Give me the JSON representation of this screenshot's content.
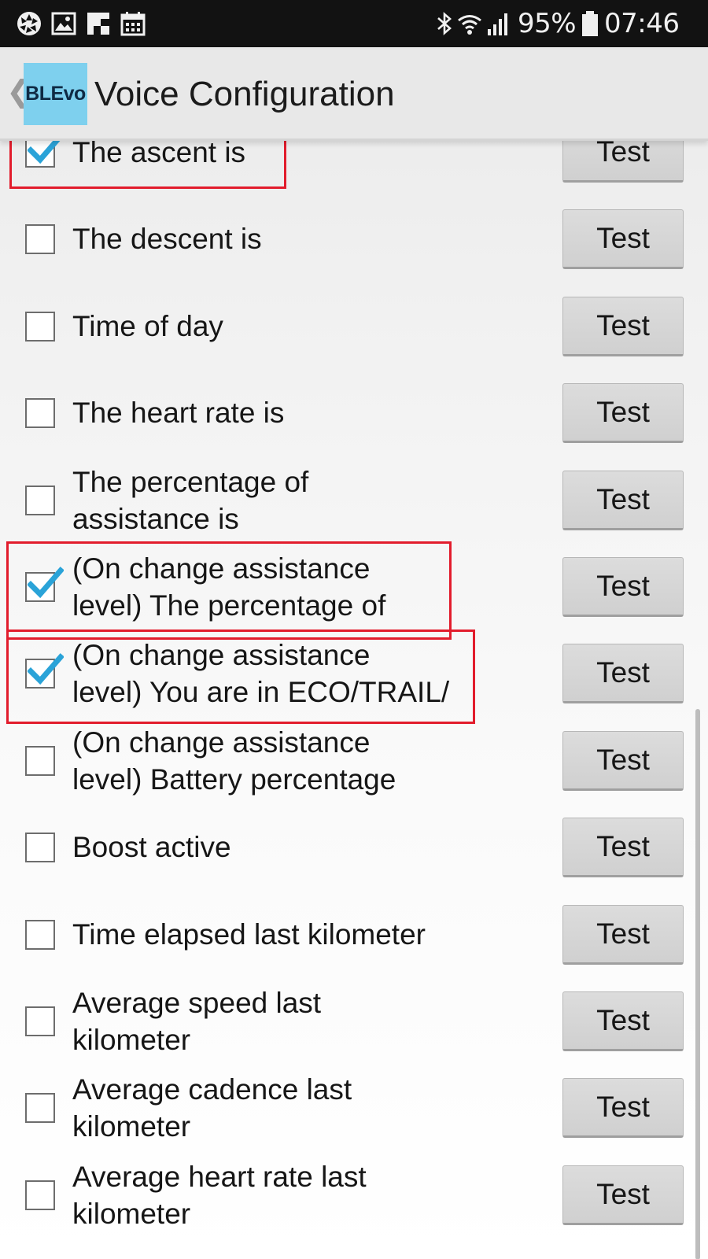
{
  "status_bar": {
    "battery": "95%",
    "time": "07:46",
    "left_icons": [
      "aperture-icon",
      "gallery-icon",
      "flipboard-icon",
      "calendar-icon"
    ],
    "right_icons": [
      "bluetooth-icon",
      "wifi-icon",
      "signal-icon",
      "battery-icon"
    ]
  },
  "header": {
    "logo_text": "BLEvo",
    "title": "Voice Configuration",
    "back_icon": "chevron-left-icon"
  },
  "colors": {
    "check_accent": "#2aa3d8",
    "highlight": "#e21c2c",
    "logo_bg": "#7ed0ee"
  },
  "rows": [
    {
      "label": "The ascent is",
      "checked": true,
      "button": "Test"
    },
    {
      "label": "The descent is",
      "checked": false,
      "button": "Test"
    },
    {
      "label": "Time of day",
      "checked": false,
      "button": "Test"
    },
    {
      "label": "The heart rate is",
      "checked": false,
      "button": "Test"
    },
    {
      "label": "The percentage of\nassistance is",
      "checked": false,
      "button": "Test"
    },
    {
      "label": "(On change assistance\nlevel) The percentage of",
      "checked": true,
      "button": "Test"
    },
    {
      "label": "(On change assistance\nlevel) You are in ECO/TRAIL/",
      "checked": true,
      "button": "Test"
    },
    {
      "label": "(On change assistance\nlevel) Battery percentage",
      "checked": false,
      "button": "Test"
    },
    {
      "label": "Boost active",
      "checked": false,
      "button": "Test"
    },
    {
      "label": "Time elapsed last kilometer",
      "checked": false,
      "button": "Test"
    },
    {
      "label": "Average speed last\nkilometer",
      "checked": false,
      "button": "Test"
    },
    {
      "label": "Average cadence last\nkilometer",
      "checked": false,
      "button": "Test"
    },
    {
      "label": "Average heart rate last\nkilometer",
      "checked": false,
      "button": "Test"
    }
  ]
}
